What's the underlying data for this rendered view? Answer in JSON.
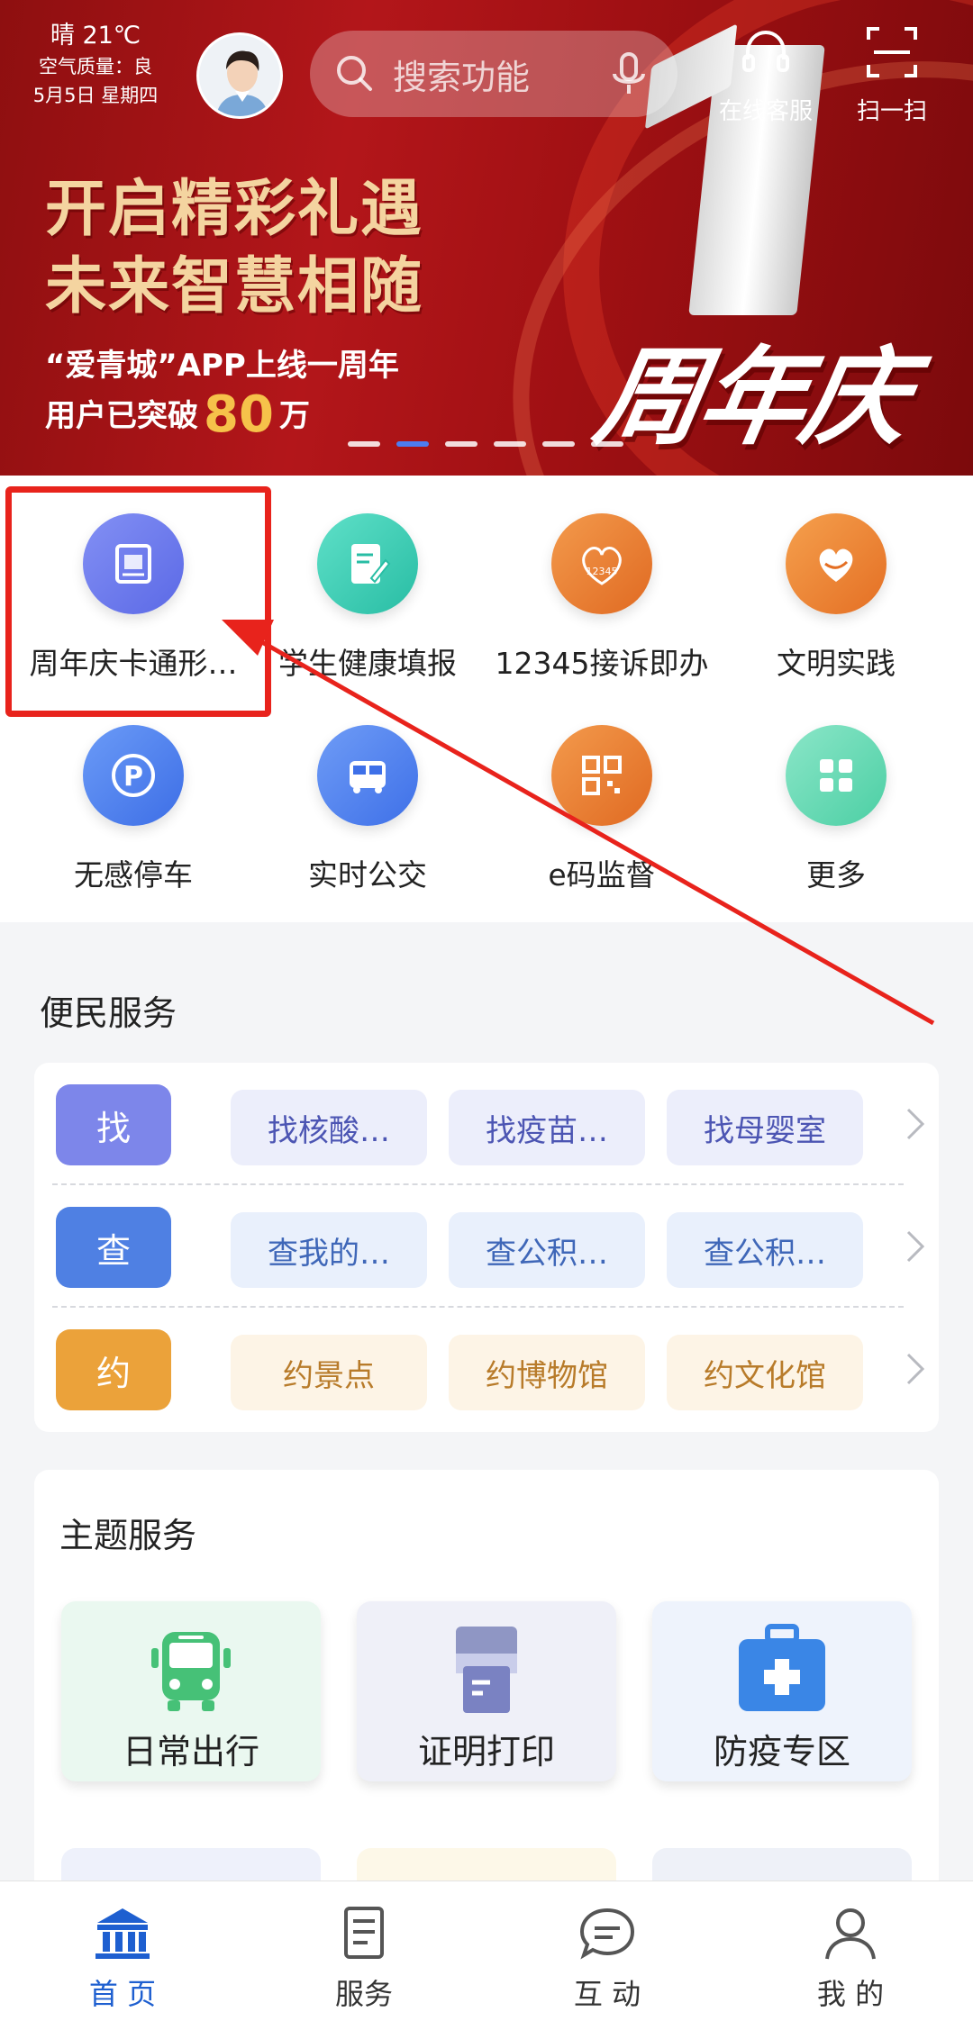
{
  "header": {
    "weather": "晴 21℃",
    "air_quality": "空气质量：良",
    "date": "5月5日  星期四",
    "search_placeholder": "搜索功能",
    "service_label": "在线客服",
    "scan_label": "扫一扫"
  },
  "banner": {
    "headline_1": "开启精彩礼遇",
    "headline_2": "未来智慧相随",
    "sub_1": "“爱青城”APP上线一周年",
    "sub_2_prefix": "用户已突破",
    "sub_2_number": "80",
    "sub_2_suffix": "万",
    "big_text": "周年庆",
    "slide_count": 6,
    "active_slide": 2
  },
  "quick_services": [
    {
      "label": "周年庆卡通形…",
      "icon": "certificate-icon",
      "color": "#6d7ef0"
    },
    {
      "label": "学生健康填报",
      "icon": "form-edit-icon",
      "color": "#3ccab6"
    },
    {
      "label": "12345接诉即办",
      "icon": "hotline-heart-icon",
      "color": "#ec7e2e"
    },
    {
      "label": "文明实践",
      "icon": "heart-icon",
      "color": "#ef8a34"
    },
    {
      "label": "无感停车",
      "icon": "parking-icon",
      "color": "#4a7ef0"
    },
    {
      "label": "实时公交",
      "icon": "bus-icon",
      "color": "#4d80f2"
    },
    {
      "label": "e码监督",
      "icon": "qr-code-icon",
      "color": "#ec7e2e"
    },
    {
      "label": "更多",
      "icon": "grid-icon",
      "color": "#62d8b0"
    }
  ],
  "convenience": {
    "title": "便民服务",
    "rows": [
      {
        "tag": "找",
        "tag_color": "#7d86ea",
        "chip_bg": "#eceefb",
        "chip_color": "#4c55b3",
        "items": [
          "找核酸…",
          "找疫苗…",
          "找母婴室"
        ]
      },
      {
        "tag": "查",
        "tag_color": "#4f80e3",
        "chip_bg": "#e9f0fc",
        "chip_color": "#3f67b8",
        "items": [
          "查我的…",
          "查公积…",
          "查公积…"
        ]
      },
      {
        "tag": "约",
        "tag_color": "#eba23a",
        "chip_bg": "#fdf4e6",
        "chip_color": "#b87b2a",
        "items": [
          "约景点",
          "约博物馆",
          "约文化馆"
        ]
      }
    ]
  },
  "theme": {
    "title": "主题服务",
    "cards": [
      {
        "label": "日常出行",
        "icon": "bus-icon",
        "bg": "#eaf8f0"
      },
      {
        "label": "证明打印",
        "icon": "printer-icon",
        "bg": "#eff0f8"
      },
      {
        "label": "防疫专区",
        "icon": "medical-kit-icon",
        "bg": "#eef3fc"
      }
    ]
  },
  "tabbar": [
    {
      "label": "首 页",
      "icon": "home-building-icon",
      "active": true
    },
    {
      "label": "服务",
      "icon": "document-icon",
      "active": false
    },
    {
      "label": "互 动",
      "icon": "chat-icon",
      "active": false
    },
    {
      "label": "我 的",
      "icon": "user-icon",
      "active": false
    }
  ]
}
